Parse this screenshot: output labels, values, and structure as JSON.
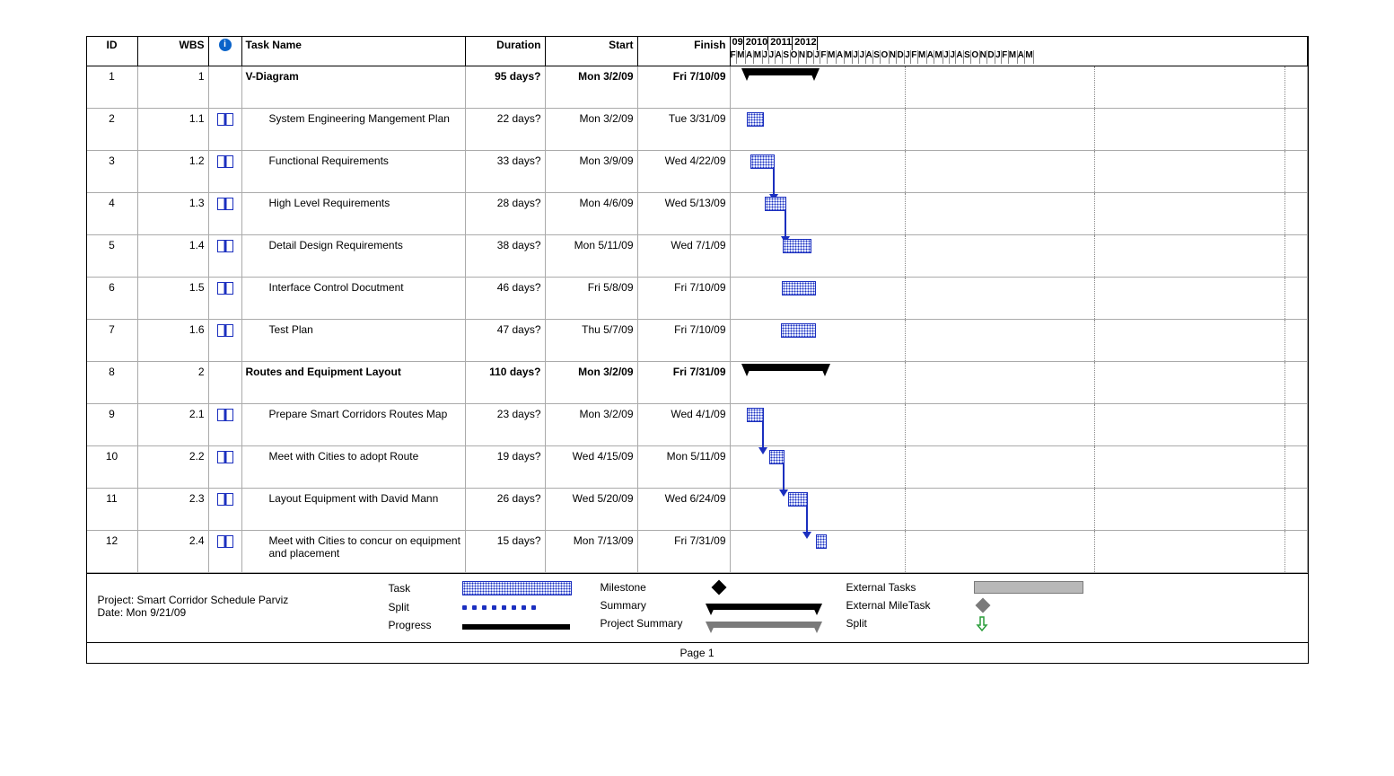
{
  "columns": {
    "id": "ID",
    "wbs": "WBS",
    "indicator": "",
    "task": "Task Name",
    "duration": "Duration",
    "start": "Start",
    "finish": "Finish"
  },
  "timeline": {
    "start_year_label": "09",
    "years": [
      {
        "label": "09",
        "months": [
          "F",
          "M",
          "A",
          "M",
          "J",
          "J",
          "A",
          "S",
          "O",
          "N",
          "D"
        ]
      },
      {
        "label": "2010",
        "months": [
          "J",
          "F",
          "M",
          "A",
          "M",
          "J",
          "J",
          "A",
          "S",
          "O",
          "N",
          "D"
        ]
      },
      {
        "label": "2011",
        "months": [
          "J",
          "F",
          "M",
          "A",
          "M",
          "J",
          "J",
          "A",
          "S",
          "O",
          "N",
          "D"
        ]
      },
      {
        "label": "2012",
        "months": [
          "J",
          "F",
          "M",
          "A",
          "M"
        ]
      }
    ]
  },
  "rows": [
    {
      "id": "1",
      "wbs": "1",
      "ind": false,
      "name": "V-Diagram",
      "bold": true,
      "indent": 0,
      "dur": "95 days?",
      "start": "Mon 3/2/09",
      "finish": "Fri 7/10/09",
      "type": "summary",
      "barStart": "2009-03-02",
      "barEnd": "2009-07-10"
    },
    {
      "id": "2",
      "wbs": "1.1",
      "ind": true,
      "name": "System Engineering Mangement Plan",
      "bold": false,
      "indent": 1,
      "dur": "22 days?",
      "start": "Mon 3/2/09",
      "finish": "Tue 3/31/09",
      "type": "task",
      "barStart": "2009-03-02",
      "barEnd": "2009-03-31"
    },
    {
      "id": "3",
      "wbs": "1.2",
      "ind": true,
      "name": "Functional Requirements",
      "bold": false,
      "indent": 1,
      "dur": "33 days?",
      "start": "Mon 3/9/09",
      "finish": "Wed 4/22/09",
      "type": "task",
      "barStart": "2009-03-09",
      "barEnd": "2009-04-22",
      "linkTo": "4"
    },
    {
      "id": "4",
      "wbs": "1.3",
      "ind": true,
      "name": "High Level Requirements",
      "bold": false,
      "indent": 1,
      "dur": "28 days?",
      "start": "Mon 4/6/09",
      "finish": "Wed 5/13/09",
      "type": "task",
      "barStart": "2009-04-06",
      "barEnd": "2009-05-13",
      "linkTo": "5"
    },
    {
      "id": "5",
      "wbs": "1.4",
      "ind": true,
      "name": "Detail Design Requirements",
      "bold": false,
      "indent": 1,
      "dur": "38 days?",
      "start": "Mon 5/11/09",
      "finish": "Wed 7/1/09",
      "type": "task",
      "barStart": "2009-05-11",
      "barEnd": "2009-07-01"
    },
    {
      "id": "6",
      "wbs": "1.5",
      "ind": true,
      "name": "Interface Control Docutment",
      "bold": false,
      "indent": 1,
      "dur": "46 days?",
      "start": "Fri 5/8/09",
      "finish": "Fri 7/10/09",
      "type": "task",
      "barStart": "2009-05-08",
      "barEnd": "2009-07-10"
    },
    {
      "id": "7",
      "wbs": "1.6",
      "ind": true,
      "name": "Test Plan",
      "bold": false,
      "indent": 1,
      "dur": "47 days?",
      "start": "Thu 5/7/09",
      "finish": "Fri 7/10/09",
      "type": "task",
      "barStart": "2009-05-07",
      "barEnd": "2009-07-10"
    },
    {
      "id": "8",
      "wbs": "2",
      "ind": false,
      "name": "Routes and Equipment Layout",
      "bold": true,
      "indent": 0,
      "dur": "110 days?",
      "start": "Mon 3/2/09",
      "finish": "Fri 7/31/09",
      "type": "summary",
      "barStart": "2009-03-02",
      "barEnd": "2009-07-31"
    },
    {
      "id": "9",
      "wbs": "2.1",
      "ind": true,
      "name": "Prepare Smart Corridors Routes Map",
      "bold": false,
      "indent": 1,
      "dur": "23 days?",
      "start": "Mon 3/2/09",
      "finish": "Wed 4/1/09",
      "type": "task",
      "barStart": "2009-03-02",
      "barEnd": "2009-04-01",
      "linkTo": "10"
    },
    {
      "id": "10",
      "wbs": "2.2",
      "ind": true,
      "name": "Meet with Cities to adopt Route",
      "bold": false,
      "indent": 1,
      "dur": "19 days?",
      "start": "Wed 4/15/09",
      "finish": "Mon 5/11/09",
      "type": "task",
      "barStart": "2009-04-15",
      "barEnd": "2009-05-11",
      "linkTo": "11"
    },
    {
      "id": "11",
      "wbs": "2.3",
      "ind": true,
      "name": "Layout Equipment with David Mann",
      "bold": false,
      "indent": 1,
      "dur": "26 days?",
      "start": "Wed 5/20/09",
      "finish": "Wed 6/24/09",
      "type": "task",
      "barStart": "2009-05-20",
      "barEnd": "2009-06-24",
      "linkTo": "12"
    },
    {
      "id": "12",
      "wbs": "2.4",
      "ind": true,
      "name": "Meet with Cities to concur on equipment and placement",
      "bold": false,
      "indent": 1,
      "dur": "15 days?",
      "start": "Mon 7/13/09",
      "finish": "Fri 7/31/09",
      "type": "task",
      "barStart": "2009-07-13",
      "barEnd": "2009-07-31"
    }
  ],
  "legend": {
    "project_line": "Project: Smart Corridor Schedule Parviz",
    "date_line": "Date: Mon 9/21/09",
    "items": {
      "task": "Task",
      "split": "Split",
      "progress": "Progress",
      "milestone": "Milestone",
      "summary": "Summary",
      "psummary": "Project Summary",
      "external": "External Tasks",
      "extms": "External MileTask",
      "splitg": "Split"
    }
  },
  "footer": "Page 1",
  "chart_data": {
    "type": "gantt",
    "title": "Smart Corridor Schedule",
    "time_axis": {
      "start": "2009-02",
      "end": "2012-05",
      "tick": "month"
    },
    "tasks": [
      {
        "id": 1,
        "wbs": "1",
        "name": "V-Diagram",
        "summary": true,
        "duration_days": 95,
        "start": "2009-03-02",
        "finish": "2009-07-10"
      },
      {
        "id": 2,
        "wbs": "1.1",
        "name": "System Engineering Mangement Plan",
        "duration_days": 22,
        "start": "2009-03-02",
        "finish": "2009-03-31"
      },
      {
        "id": 3,
        "wbs": "1.2",
        "name": "Functional Requirements",
        "duration_days": 33,
        "start": "2009-03-09",
        "finish": "2009-04-22",
        "successor": 4
      },
      {
        "id": 4,
        "wbs": "1.3",
        "name": "High Level Requirements",
        "duration_days": 28,
        "start": "2009-04-06",
        "finish": "2009-05-13",
        "successor": 5
      },
      {
        "id": 5,
        "wbs": "1.4",
        "name": "Detail Design Requirements",
        "duration_days": 38,
        "start": "2009-05-11",
        "finish": "2009-07-01"
      },
      {
        "id": 6,
        "wbs": "1.5",
        "name": "Interface Control Docutment",
        "duration_days": 46,
        "start": "2009-05-08",
        "finish": "2009-07-10"
      },
      {
        "id": 7,
        "wbs": "1.6",
        "name": "Test Plan",
        "duration_days": 47,
        "start": "2009-05-07",
        "finish": "2009-07-10"
      },
      {
        "id": 8,
        "wbs": "2",
        "name": "Routes and Equipment Layout",
        "summary": true,
        "duration_days": 110,
        "start": "2009-03-02",
        "finish": "2009-07-31"
      },
      {
        "id": 9,
        "wbs": "2.1",
        "name": "Prepare Smart Corridors Routes Map",
        "duration_days": 23,
        "start": "2009-03-02",
        "finish": "2009-04-01",
        "successor": 10
      },
      {
        "id": 10,
        "wbs": "2.2",
        "name": "Meet with Cities to adopt Route",
        "duration_days": 19,
        "start": "2009-04-15",
        "finish": "2009-05-11",
        "successor": 11
      },
      {
        "id": 11,
        "wbs": "2.3",
        "name": "Layout Equipment with David Mann",
        "duration_days": 26,
        "start": "2009-05-20",
        "finish": "2009-06-24",
        "successor": 12
      },
      {
        "id": 12,
        "wbs": "2.4",
        "name": "Meet with Cities to concur on equipment and placement",
        "duration_days": 15,
        "start": "2009-07-13",
        "finish": "2009-07-31"
      }
    ]
  }
}
